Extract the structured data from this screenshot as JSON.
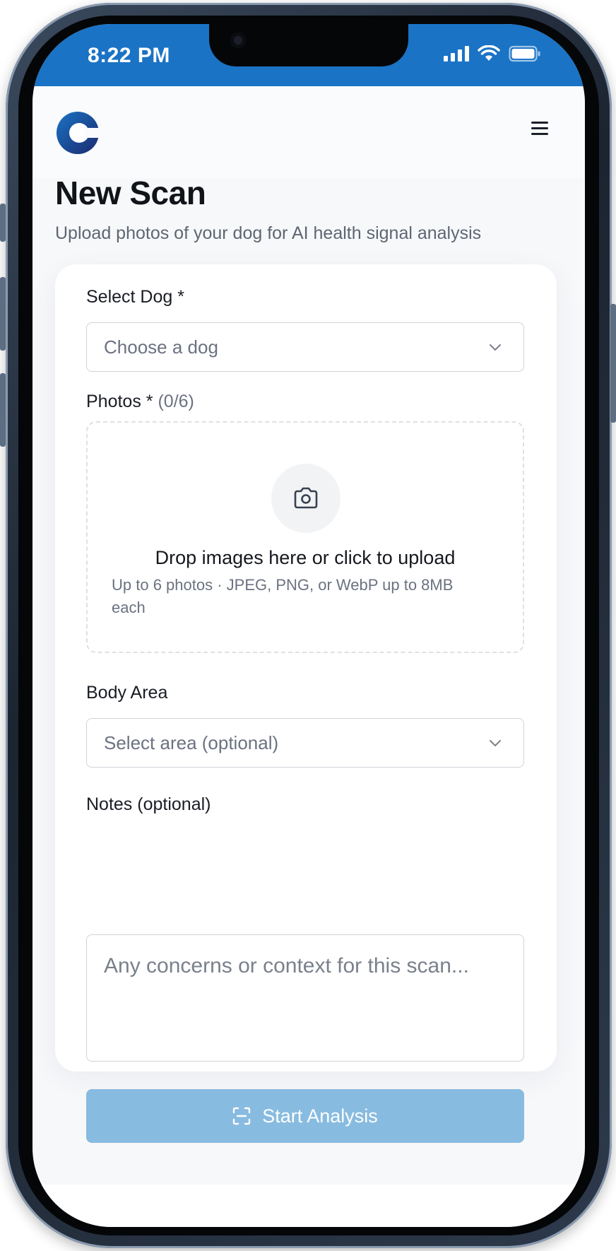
{
  "status_bar": {
    "time": "8:22 PM",
    "icons": [
      "signal-icon",
      "wifi-icon",
      "battery-icon"
    ],
    "background_color": "#1a73c5"
  },
  "header": {
    "logo": "app-logo-icon",
    "logo_colors": [
      "#1a73c5",
      "#1b2a6e"
    ],
    "menu_icon": "hamburger-menu-icon"
  },
  "page": {
    "title": "New Scan",
    "subtitle": "Upload photos of your dog for AI health signal analysis"
  },
  "form": {
    "dog": {
      "label": "Select Dog *",
      "placeholder": "Choose a dog",
      "icon": "chevron-down-icon"
    },
    "photos": {
      "label": "Photos *",
      "count": "(0/6)",
      "dropzone_icon": "camera-icon",
      "dropzone_title": "Drop images here or click to upload",
      "dropzone_hint": "Up to 6 photos · JPEG, PNG, or WebP up to 8MB each"
    },
    "body_area": {
      "label": "Body Area",
      "placeholder": "Select area (optional)",
      "icon": "chevron-down-icon"
    },
    "notes": {
      "label": "Notes (optional)",
      "placeholder": "Any concerns or context for this scan...",
      "value": ""
    },
    "submit": {
      "label": "Start Analysis",
      "icon": "scan-icon",
      "color": "#88bbe0",
      "disabled": true
    }
  }
}
